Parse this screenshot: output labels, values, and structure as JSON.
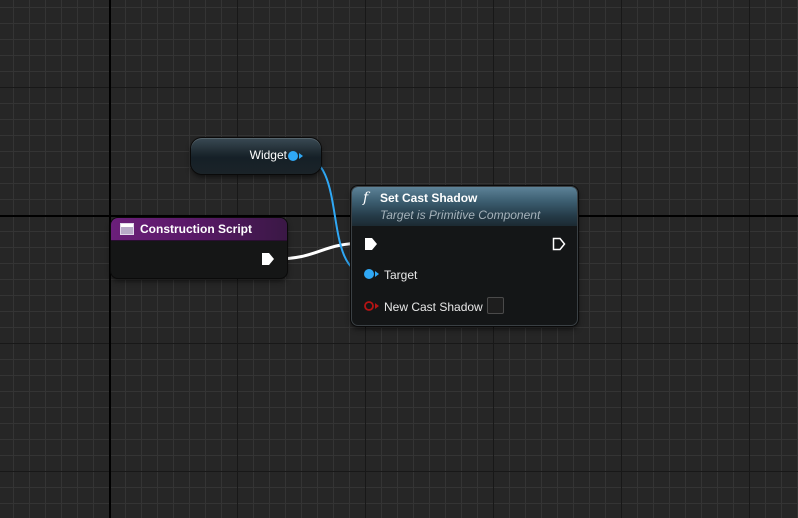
{
  "graph": {
    "widget_node": {
      "label": "Widget"
    },
    "event_node": {
      "title": "Construction Script"
    },
    "function_node": {
      "icon": "f",
      "title": "Set Cast Shadow",
      "subtitle": "Target is Primitive Component",
      "pins": {
        "target_label": "Target",
        "new_cast_shadow_label": "New Cast Shadow"
      }
    }
  },
  "colors": {
    "object_pin": "#2fa8f5",
    "exec_pin": "#ffffff",
    "bool_pin": "#b51414",
    "event_header": "#6b1f7a",
    "function_header": "#3d5f72"
  },
  "icons": {
    "event": "event-graph-icon",
    "function": "function-icon"
  }
}
